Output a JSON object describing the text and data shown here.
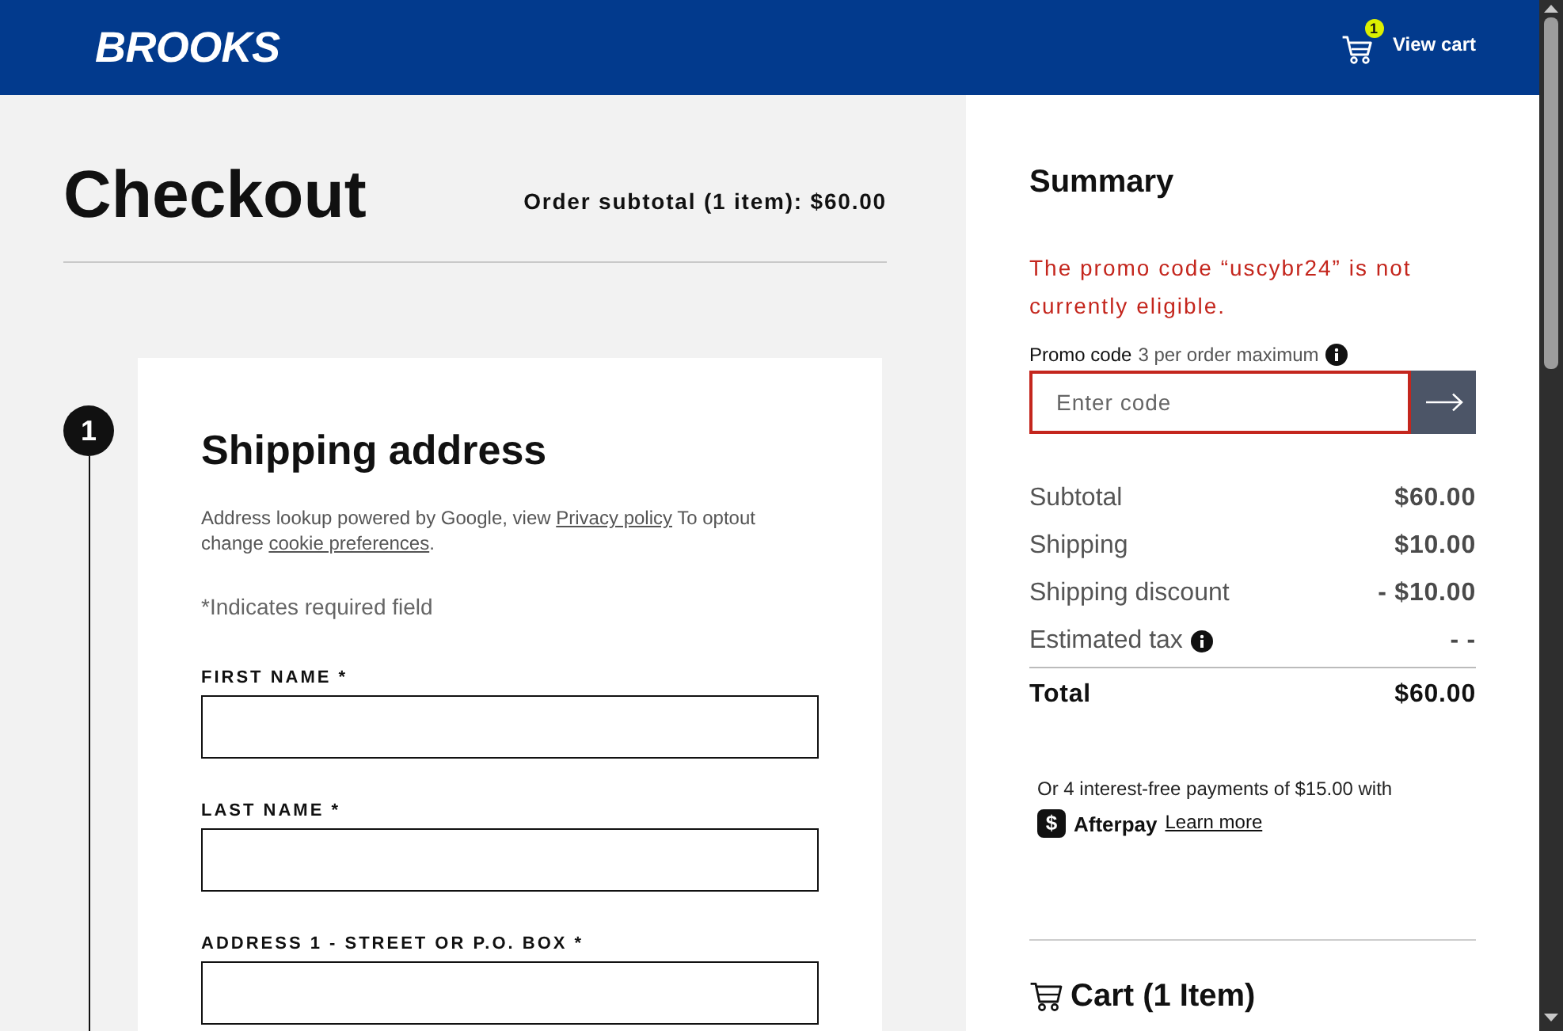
{
  "header": {
    "logo": "BROOKS",
    "cart_count": "1",
    "cart_label": "View cart"
  },
  "checkout": {
    "title": "Checkout",
    "order_subtotal": "Order subtotal (1 item): $60.00"
  },
  "step": {
    "number": "1",
    "title": "Shipping address",
    "lookup_note": {
      "before": "Address lookup powered by Google, view ",
      "privacy_link": "Privacy policy",
      "middle": " To optout change ",
      "cookie_link": "cookie preferences",
      "after": "."
    },
    "required_note": "*Indicates required field",
    "fields": [
      {
        "label": "FIRST NAME *"
      },
      {
        "label": "LAST NAME *"
      },
      {
        "label": "ADDRESS 1 - STREET OR P.O. BOX *"
      }
    ]
  },
  "summary": {
    "title": "Summary",
    "promo_error": "The promo code “uscybr24” is not currently eligible.",
    "promo": {
      "label": "Promo code",
      "hint": "3 per order maximum",
      "placeholder": "Enter code",
      "invalid": true
    },
    "rows": [
      {
        "label": "Subtotal",
        "value": "$60.00",
        "info": false
      },
      {
        "label": "Shipping",
        "value": "$10.00",
        "info": false
      },
      {
        "label": "Shipping discount",
        "value": "- $10.00",
        "info": false
      },
      {
        "label": "Estimated tax",
        "value": "- -",
        "info": true
      }
    ],
    "total": {
      "label": "Total",
      "value": "$60.00"
    },
    "afterpay": {
      "intro": "Or 4 interest-free payments of $15.00 with",
      "logo_mark": "$",
      "brand": "Afterpay",
      "link": "Learn more"
    },
    "cart_heading": "Cart (1 Item)"
  }
}
